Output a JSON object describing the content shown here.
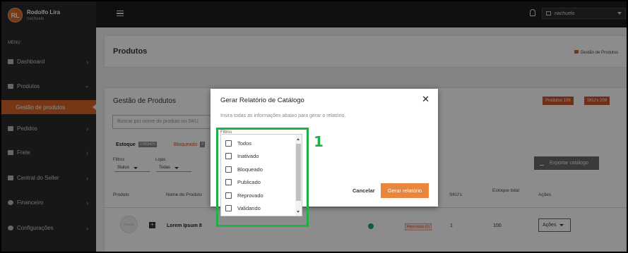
{
  "user": {
    "initials": "RL",
    "name": "Rodolfo Lira",
    "subtitle": "nachuelo"
  },
  "sidebar": {
    "menu_label": "MENU",
    "items": [
      {
        "label": "Dashboard",
        "icon": "dashboard-icon"
      },
      {
        "label": "Produtos",
        "icon": "box-icon"
      },
      {
        "label": "Gestão de produtos",
        "active": true
      },
      {
        "label": "Pedidos",
        "icon": "bag-icon"
      },
      {
        "label": "Frete",
        "icon": "truck-icon"
      },
      {
        "label": "Central do Seller",
        "icon": "list-icon"
      },
      {
        "label": "Financeiro",
        "icon": "dollar-icon"
      },
      {
        "label": "Configurações",
        "icon": "gear-icon"
      }
    ]
  },
  "topbar": {
    "store_select": "nachuelo"
  },
  "page": {
    "title": "Produtos",
    "breadcrumb": "Gestão de Produtos",
    "section_title": "Gestão de Produtos",
    "badges": [
      "Produtos 106",
      "SKU's 208"
    ],
    "search_placeholder": "Buscar por nome do produto ou SKU",
    "stock_label": "Estoque",
    "stock_count": "17859476",
    "blocked_label": "Bloqueado",
    "blocked_count": "0",
    "filters_label": "Filtros",
    "status_select": "Status",
    "stores_label": "Lojas",
    "stores_select": "Todas",
    "export_button": "Exportar catálogo"
  },
  "table": {
    "headers": {
      "product": "Produto",
      "name": "Nome do Produto",
      "skus": "SKU's",
      "stock": "Estoque total",
      "actions": "Ações"
    },
    "rows": [
      {
        "thumb": "PONTO",
        "name": "Lorem Ipsum 8",
        "status_badge": "Reprovado (1)",
        "skus": "1",
        "stock": "100",
        "actions": "Ações"
      }
    ]
  },
  "modal": {
    "title": "Gerar Relatório de Catálogo",
    "close": "✕",
    "description": "Insira todas as informações abaixo para gerar o relatório.",
    "filters_label": "Filtros",
    "options": [
      "Todos",
      "Inativado",
      "Bloqueado",
      "Publicado",
      "Reprovado",
      "Validando"
    ],
    "cancel_button": "Cancelar",
    "submit_button": "Gerar relatório"
  },
  "annotation": {
    "number": "1",
    "color": "#1fb046"
  },
  "colors": {
    "accent": "#d9642a",
    "sidebar": "#2b2b2b",
    "topbar": "#1e1e1e"
  }
}
